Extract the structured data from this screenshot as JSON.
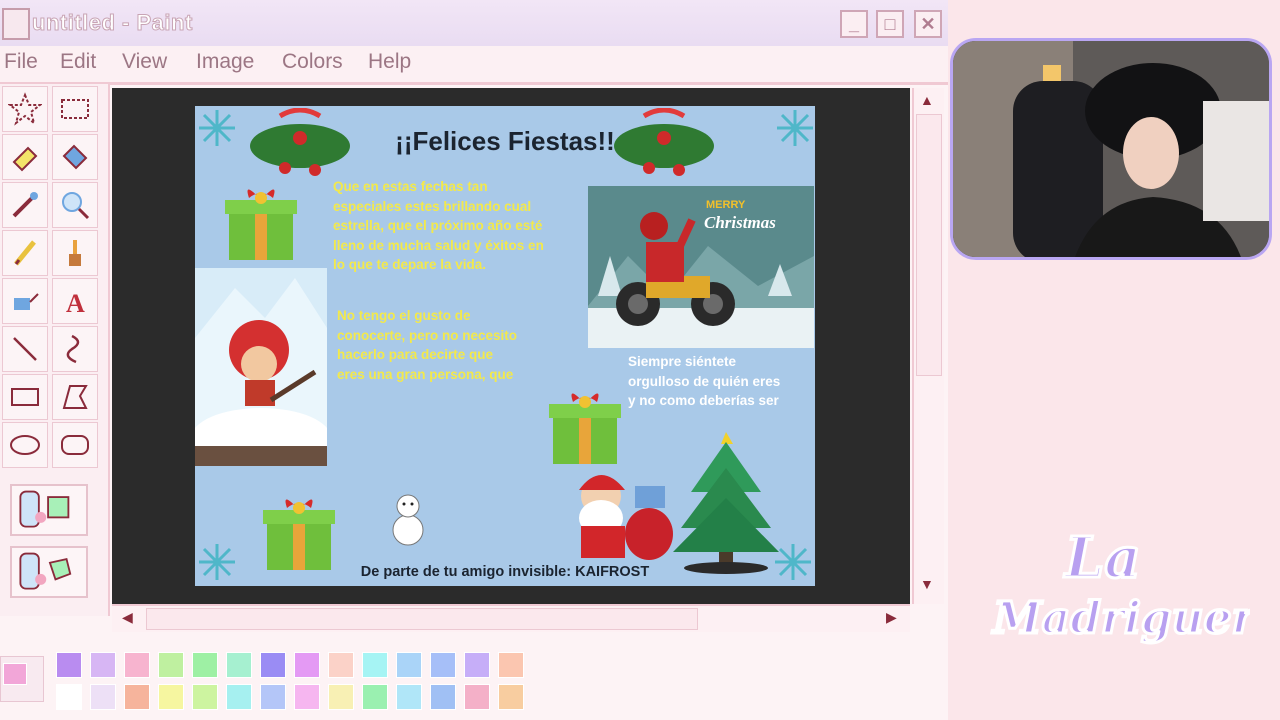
{
  "window": {
    "title": "untitled - Paint",
    "buttons": {
      "minimize": "_",
      "maximize": "□",
      "close": "✕"
    }
  },
  "menu": [
    {
      "label": "File",
      "key": "F"
    },
    {
      "label": "Edit",
      "key": "E"
    },
    {
      "label": "View",
      "key": "V"
    },
    {
      "label": "Image",
      "key": "I"
    },
    {
      "label": "Colors",
      "key": "C"
    },
    {
      "label": "Help",
      "key": "H"
    }
  ],
  "tools": [
    "free-form-select",
    "select",
    "eraser",
    "fill",
    "pick-color",
    "magnifier",
    "pencil",
    "brush",
    "airbrush",
    "text",
    "line",
    "curve",
    "rectangle",
    "polygon",
    "ellipse",
    "rounded-rectangle"
  ],
  "card": {
    "title": "¡¡Felices Fiestas!!",
    "para1": [
      "Que en estas fechas tan",
      "especiales estes brillando cual",
      "estrella, que el próximo año esté",
      "lleno de mucha salud y éxitos en",
      "lo que te depare la vida."
    ],
    "para2": [
      "No tengo el gusto de",
      "conocerte, pero no necesito",
      "hacerlo para decirte que",
      "eres una gran persona, que"
    ],
    "para3": [
      "Siempre siéntete",
      "orgulloso de quién eres",
      "y no como deberías ser"
    ],
    "christmas_sign_1": "MERRY",
    "christmas_sign_2": "Christmas",
    "footer": "De parte de tu amigo invisible: KAIFROST"
  },
  "palette": {
    "active": "#f2a6d8",
    "row1": [
      "#b98cf0",
      "#d7b6f4",
      "#f7b4cf",
      "#bff0a0",
      "#9ef0a4",
      "#a6f0d0",
      "#9a8cf4",
      "#e49af4",
      "#fbd2c8",
      "#a6f4f4",
      "#aad4f8",
      "#a6bff8",
      "#c6aef8",
      "#fbc6b0"
    ],
    "row2": [
      "#ffffff",
      "#ede0f6",
      "#f6b49c",
      "#f6f6a0",
      "#cdf4a0",
      "#a6f0f0",
      "#b4c6f8",
      "#f6b6f0",
      "#f8f0b4",
      "#9af0b0",
      "#b0e6f8",
      "#a0c0f4",
      "#f4b0c8",
      "#f8cda0"
    ]
  },
  "brand_logo": {
    "line1": "La",
    "line2": "Madriguera"
  }
}
